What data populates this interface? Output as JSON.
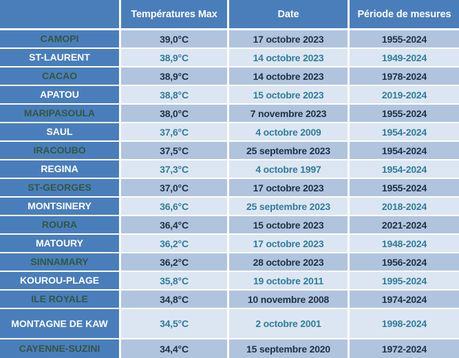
{
  "table": {
    "name": "records-temperatures-max-guyane",
    "columns": [
      {
        "key": "station",
        "label": ""
      },
      {
        "key": "temp",
        "label": "Températures Max"
      },
      {
        "key": "date",
        "label": "Date"
      },
      {
        "key": "period",
        "label": "Période de mesures"
      }
    ],
    "rows": [
      {
        "station": "CAMOPI",
        "temp": "39,0°C",
        "date": "17 octobre 2023",
        "period": "1955-2024"
      },
      {
        "station": "ST-LAURENT",
        "temp": "38,9°C",
        "date": "14 octobre 2023",
        "period": "1949-2024"
      },
      {
        "station": "CACAO",
        "temp": "38,9°C",
        "date": "14 octobre 2023",
        "period": "1978-2024"
      },
      {
        "station": "APATOU",
        "temp": "38,8°C",
        "date": "15 octobre 2023",
        "period": "2019-2024"
      },
      {
        "station": "MARIPASOULA",
        "temp": "38,0°C",
        "date": "7 novembre 2023",
        "period": "1955-2024"
      },
      {
        "station": "SAUL",
        "temp": "37,6°C",
        "date": "4 octobre 2009",
        "period": "1954-2024"
      },
      {
        "station": "IRACOUBO",
        "temp": "37,5°C",
        "date": "25 septembre 2023",
        "period": "1954-2024"
      },
      {
        "station": "REGINA",
        "temp": "37,3°C",
        "date": "4 octobre 1997",
        "period": "1954-2024"
      },
      {
        "station": "ST-GEORGES",
        "temp": "37,0°C",
        "date": "17 octobre 2023",
        "period": "1955-2024"
      },
      {
        "station": "MONTSINERY",
        "temp": "36,6°C",
        "date": "25 septembre 2023",
        "period": "2018-2024"
      },
      {
        "station": "ROURA",
        "temp": "36,4°C",
        "date": "15 octobre 2023",
        "period": "2021-2024"
      },
      {
        "station": "MATOURY",
        "temp": "36,2°C",
        "date": "17 octobre 2023",
        "period": "1948-2024"
      },
      {
        "station": "SINNAMARY",
        "temp": "36,2°C",
        "date": "28 octobre 2023",
        "period": "1956-2024"
      },
      {
        "station": "KOUROU-PLAGE",
        "temp": "35,8°C",
        "date": "19 octobre 2011",
        "period": "1995-2024"
      },
      {
        "station": "ILE ROYALE",
        "temp": "34,8°C",
        "date": "10 novembre 2008",
        "period": "1974-2024"
      },
      {
        "station": "MONTAGNE DE KAW",
        "temp": "34,5°C",
        "date": "2 octobre 2001",
        "period": "1998-2024"
      },
      {
        "station": "CAYENNE-SUZINI",
        "temp": "34,4°C",
        "date": "15 septembre 2020",
        "period": "1972-2024"
      }
    ]
  },
  "colors": {
    "header_background": "#4a7ebb",
    "header_text": "#ffffff",
    "station_background": "#4a7ebb",
    "station_text_odd": "#32573f",
    "station_text_even": "#ffffff",
    "row_odd_background": "#b0c4de",
    "row_even_background": "#dce6f2",
    "row_odd_text": "#1d3144",
    "row_even_text": "#2d7d99",
    "gridline": "#ffffff"
  }
}
